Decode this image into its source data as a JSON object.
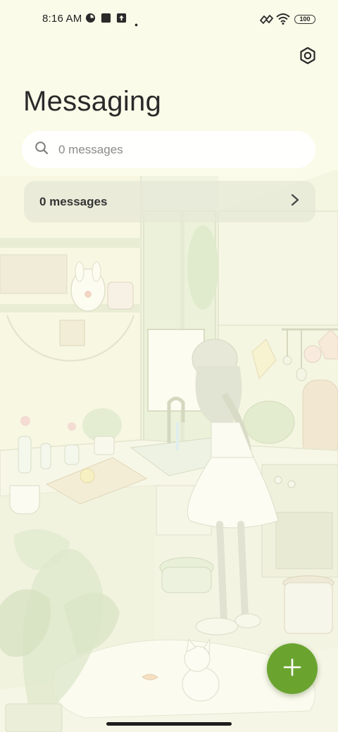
{
  "status_bar": {
    "time": "8:16 AM",
    "battery": "100",
    "icons": [
      "data-saver-icon",
      "app-notification-icon",
      "upload-icon",
      "dot-icon",
      "vibrate-icon",
      "wifi-icon",
      "battery-icon"
    ]
  },
  "header": {
    "title": "Messaging",
    "settings_icon": "settings-gear-icon"
  },
  "search": {
    "placeholder": "0 messages",
    "value": ""
  },
  "conversations": {
    "row_label": "0 messages",
    "row_icon": "chevron-right-icon"
  },
  "fab": {
    "icon": "plus-icon",
    "color": "#6aa42f"
  },
  "theme": {
    "background": "#fbfbea",
    "accent": "#6aa42f",
    "wallpaper": "cozy-kitchen-illustration"
  }
}
